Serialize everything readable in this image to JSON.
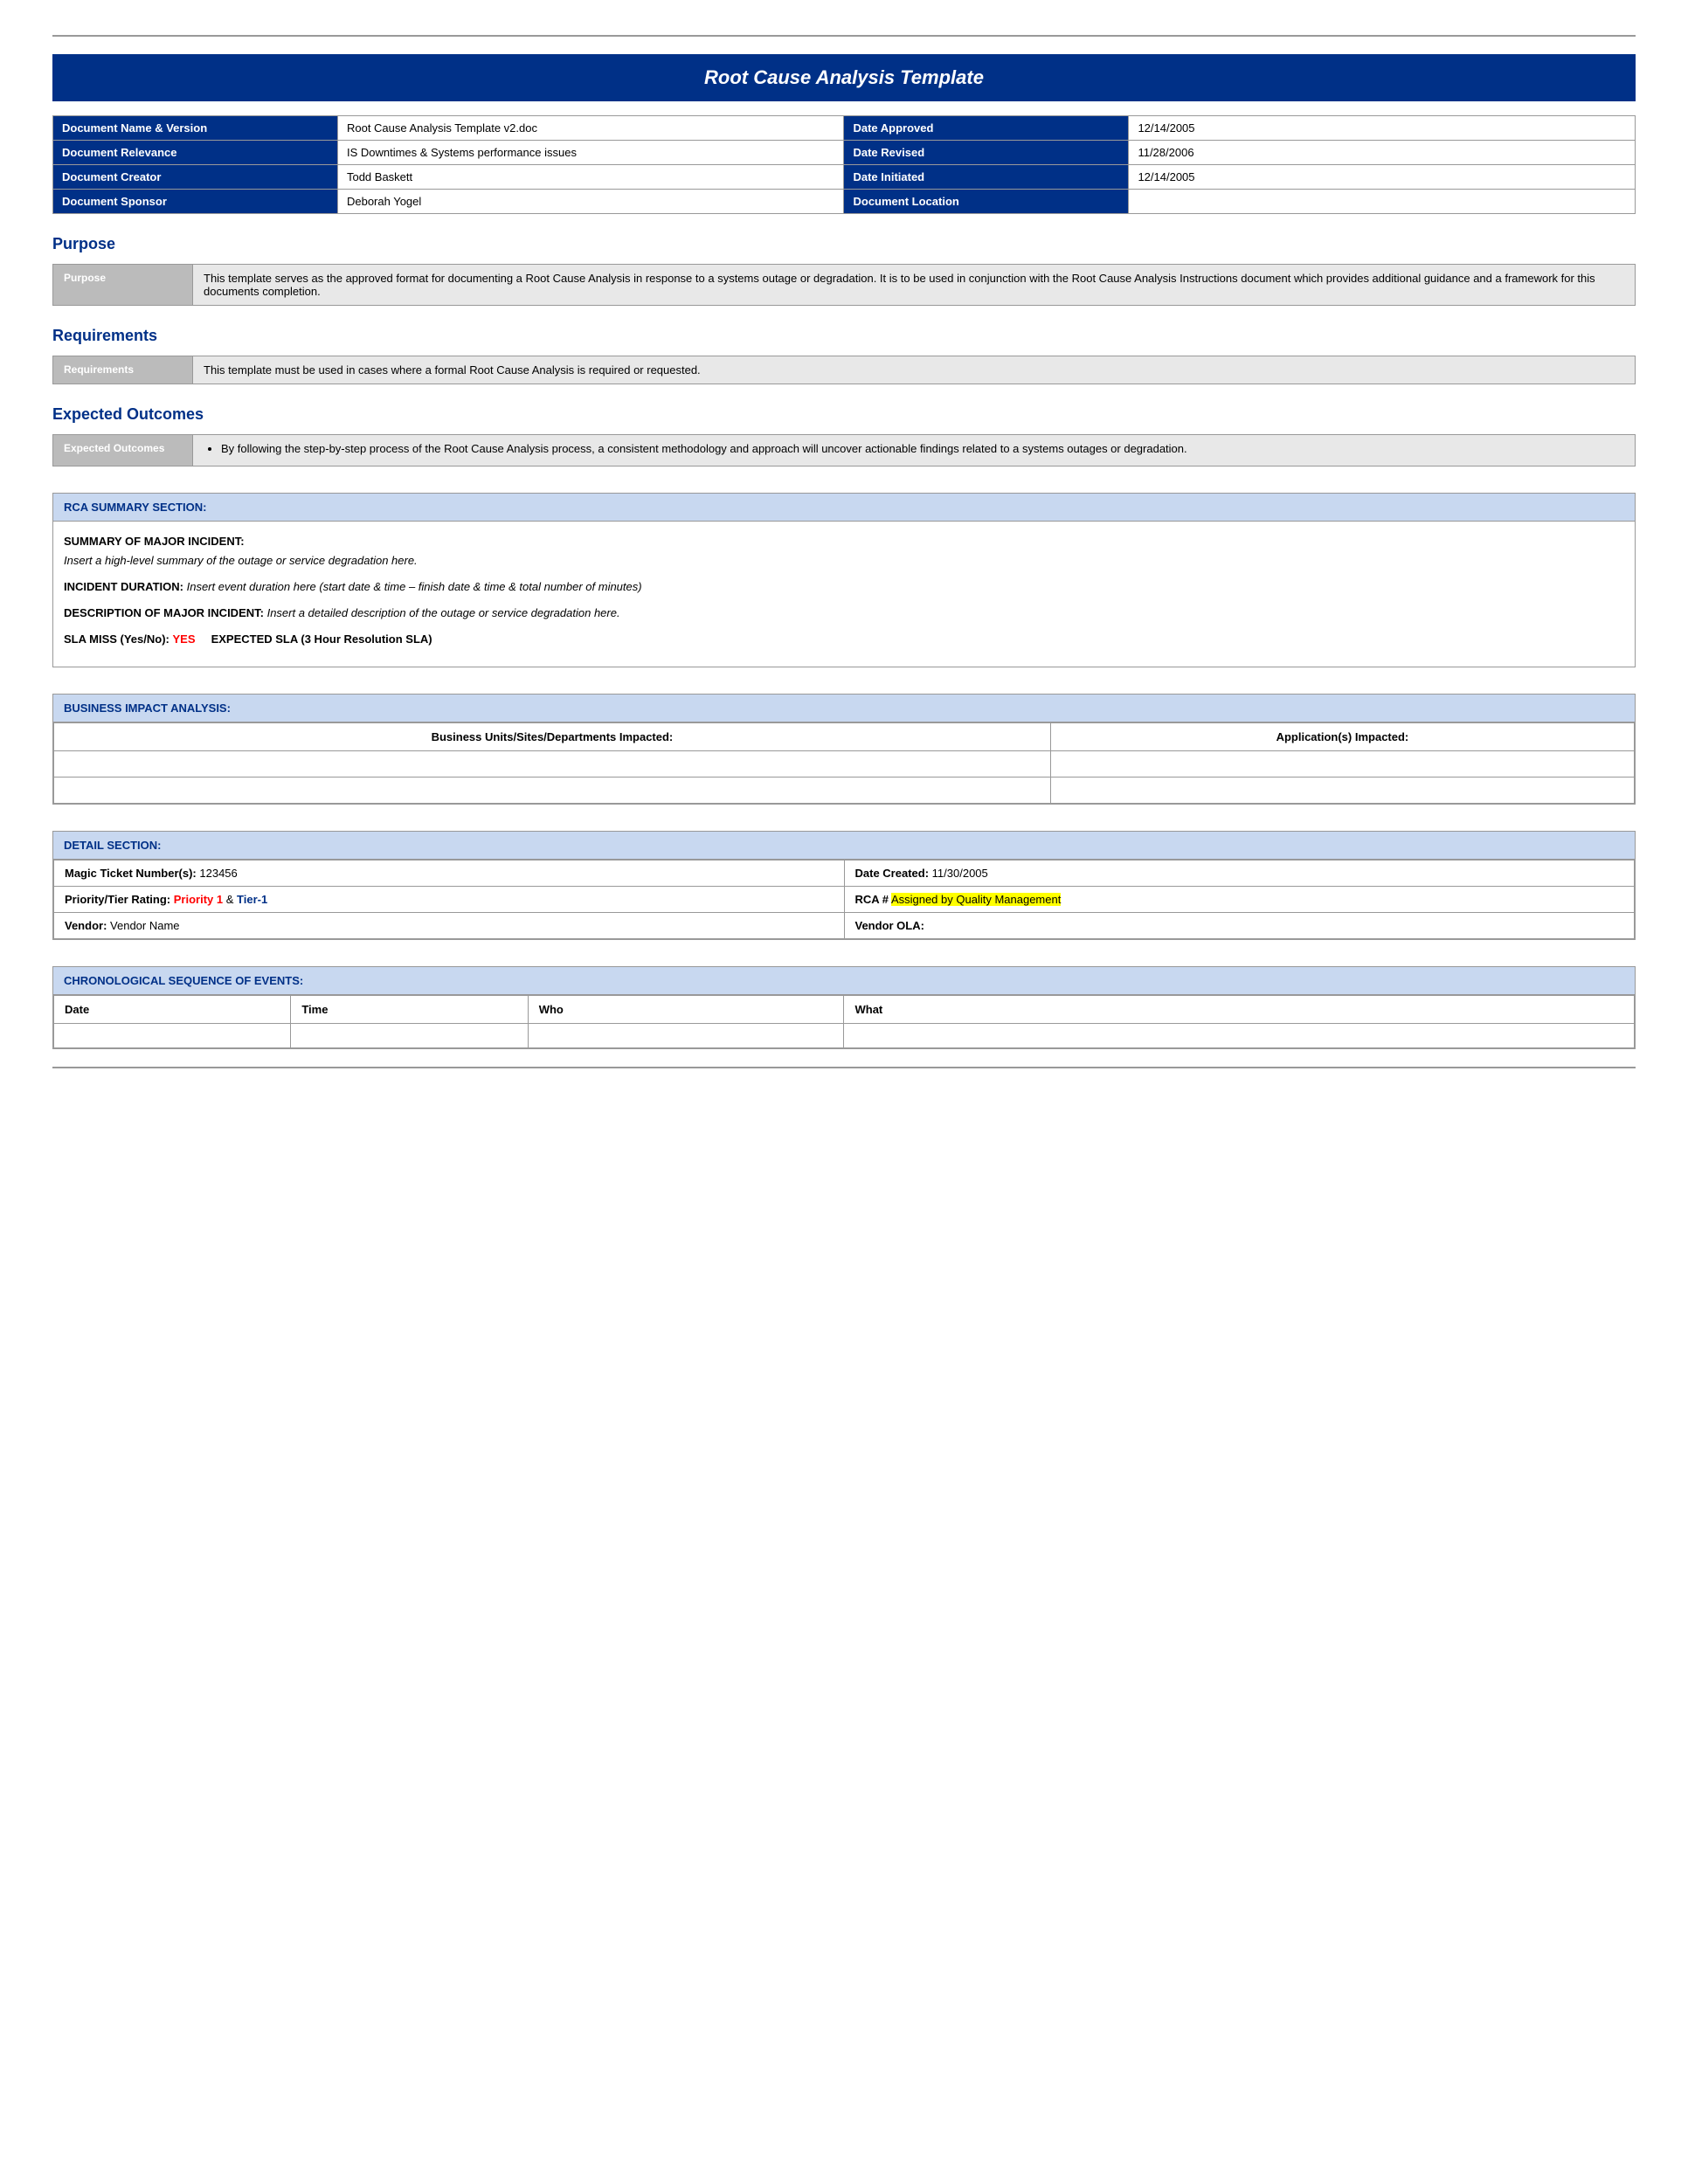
{
  "title": "Root Cause Analysis Template",
  "doc_info": {
    "rows": [
      {
        "left_label": "Document Name & Version",
        "left_value": "Root Cause Analysis Template v2.doc",
        "right_label": "Date Approved",
        "right_value": "12/14/2005"
      },
      {
        "left_label": "Document Relevance",
        "left_value": "IS Downtimes & Systems performance issues",
        "right_label": "Date Revised",
        "right_value": "11/28/2006"
      },
      {
        "left_label": "Document Creator",
        "left_value": "Todd Baskett",
        "right_label": "Date Initiated",
        "right_value": "12/14/2005"
      },
      {
        "left_label": "Document Sponsor",
        "left_value": "Deborah Yogel",
        "right_label": "Document Location",
        "right_value": ""
      }
    ]
  },
  "sections": {
    "purpose": {
      "heading": "Purpose",
      "label": "Purpose",
      "content": "This template serves as the approved format for documenting a Root Cause Analysis in response to a systems outage or degradation. It is to be used in conjunction with the Root Cause Analysis Instructions document which provides additional guidance and a framework for this documents completion."
    },
    "requirements": {
      "heading": "Requirements",
      "label": "Requirements",
      "content": "This template must be used in cases where a formal Root Cause Analysis is required or requested."
    },
    "expected_outcomes": {
      "heading": "Expected Outcomes",
      "label": "Expected Outcomes",
      "bullet": "By following the step-by-step process of the Root Cause Analysis process, a consistent methodology and approach will uncover actionable findings related to a systems outages or degradation."
    }
  },
  "rca_summary": {
    "header": "RCA SUMMARY SECTION:",
    "summary_label": "SUMMARY OF MAJOR INCIDENT:",
    "summary_text": "Insert a high-level summary of the outage or service degradation here.",
    "incident_label": "INCIDENT DURATION:",
    "incident_text": "Insert event duration here (start date &  time – finish date & time & total number of minutes)",
    "description_label": "DESCRIPTION OF MAJOR INCIDENT:",
    "description_text": "Insert a detailed description of the outage or service degradation here.",
    "sla_label": "SLA MISS (Yes/No):",
    "sla_yes": "YES",
    "sla_expected": "EXPECTED SLA (3 Hour Resolution SLA)"
  },
  "business_impact": {
    "header": "BUSINESS IMPACT ANALYSIS:",
    "col1": "Business Units/Sites/Departments Impacted:",
    "col2": "Application(s) Impacted:"
  },
  "detail_section": {
    "header": "DETAIL SECTION:",
    "magic_label": "Magic Ticket Number(s):",
    "magic_value": "123456",
    "date_label": "Date Created:",
    "date_value": "11/30/2005",
    "priority_label": "Priority/Tier Rating:",
    "priority_text": "Priority 1",
    "tier_text": "Tier-1",
    "rca_label": "RCA #",
    "rca_value": "Assigned by Quality Management",
    "vendor_label": "Vendor:",
    "vendor_value": "Vendor Name",
    "vendor_ola_label": "Vendor OLA:"
  },
  "chronological": {
    "header": "CHRONOLOGICAL SEQUENCE OF EVENTS:",
    "columns": [
      "Date",
      "Time",
      "Who",
      "What"
    ]
  }
}
